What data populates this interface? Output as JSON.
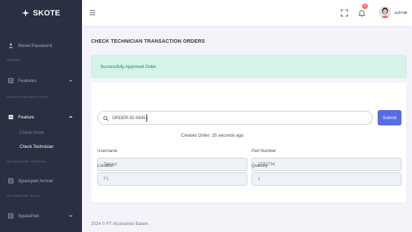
{
  "app": {
    "brand": "SKOTE"
  },
  "sidebar": {
    "reset_password": "Reset Password",
    "sections": [
      "ORDER",
      "CHECK TRANSACTION",
      "SPAREPART ARRIVAL",
      "SPAREPART DATA"
    ],
    "features": "Features",
    "feature": "Feature",
    "submenu": [
      "Check Order",
      "Check Technician"
    ],
    "sparepart_arrival": "Sparepart Arrival",
    "sparepart": "SparePart"
  },
  "topbar": {
    "notification_count": "0",
    "username": "admin"
  },
  "main": {
    "title": "CHECK TECHNICIAN TRANSACTION ORDERS",
    "alert": "Successfully Approved Order",
    "search_value": "ORDER-ID-09451",
    "submit_label": "Submit",
    "created": "Created Order: 25 seconds ago",
    "fields": {
      "username_label": "Username",
      "username_value": "Teknisi",
      "part_number_label": "Part Number",
      "part_number_value": "2773794",
      "location_label": "Location",
      "location_value": "F1",
      "quantity_label": "Quantity",
      "quantity_value": "1"
    }
  },
  "footer": "2024 © PT Alcotraindo Batam."
}
